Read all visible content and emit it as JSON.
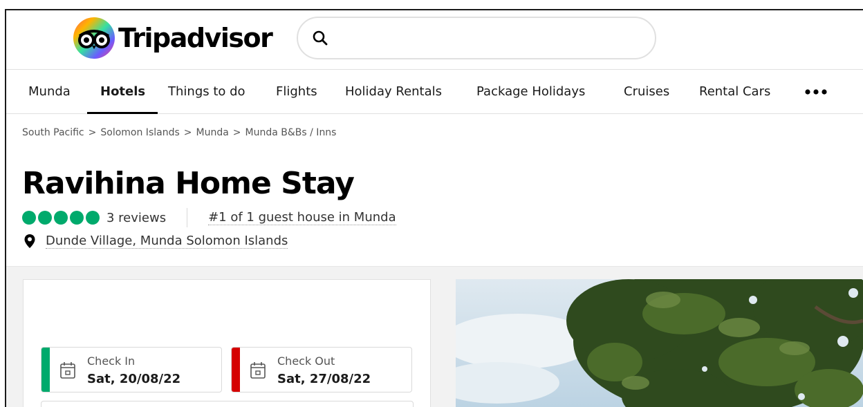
{
  "header": {
    "logo_text": "Tripadvisor",
    "search": {
      "placeholder": "",
      "value": ""
    }
  },
  "nav": {
    "items": [
      {
        "label": "Munda"
      },
      {
        "label": "Hotels",
        "active": true
      },
      {
        "label": "Things to do"
      },
      {
        "label": "Flights"
      },
      {
        "label": "Holiday Rentals"
      },
      {
        "label": "Package Holidays"
      },
      {
        "label": "Cruises"
      },
      {
        "label": "Rental Cars"
      }
    ],
    "more_label": "•••"
  },
  "breadcrumb": {
    "items": [
      "South Pacific",
      "Solomon Islands",
      "Munda",
      "Munda B&Bs / Inns"
    ],
    "separator": ">"
  },
  "listing": {
    "title": "Ravihina Home Stay",
    "rating_bubbles": 5,
    "reviews_label": "3 reviews",
    "rank_label": "#1 of 1 guest house in Munda",
    "address": "Dunde Village, Munda Solomon Islands"
  },
  "booking": {
    "check_in": {
      "label": "Check In",
      "value": "Sat, 20/08/22",
      "color": "#00aa6c"
    },
    "check_out": {
      "label": "Check Out",
      "value": "Sat, 27/08/22",
      "color": "#d50000"
    }
  },
  "colors": {
    "bubble": "#00aa6c",
    "text": "#1a1a1a",
    "muted": "#555555"
  },
  "icons": {
    "search": "search-icon",
    "location": "map-pin-icon",
    "calendar": "calendar-icon",
    "more": "more-horizontal-icon"
  }
}
